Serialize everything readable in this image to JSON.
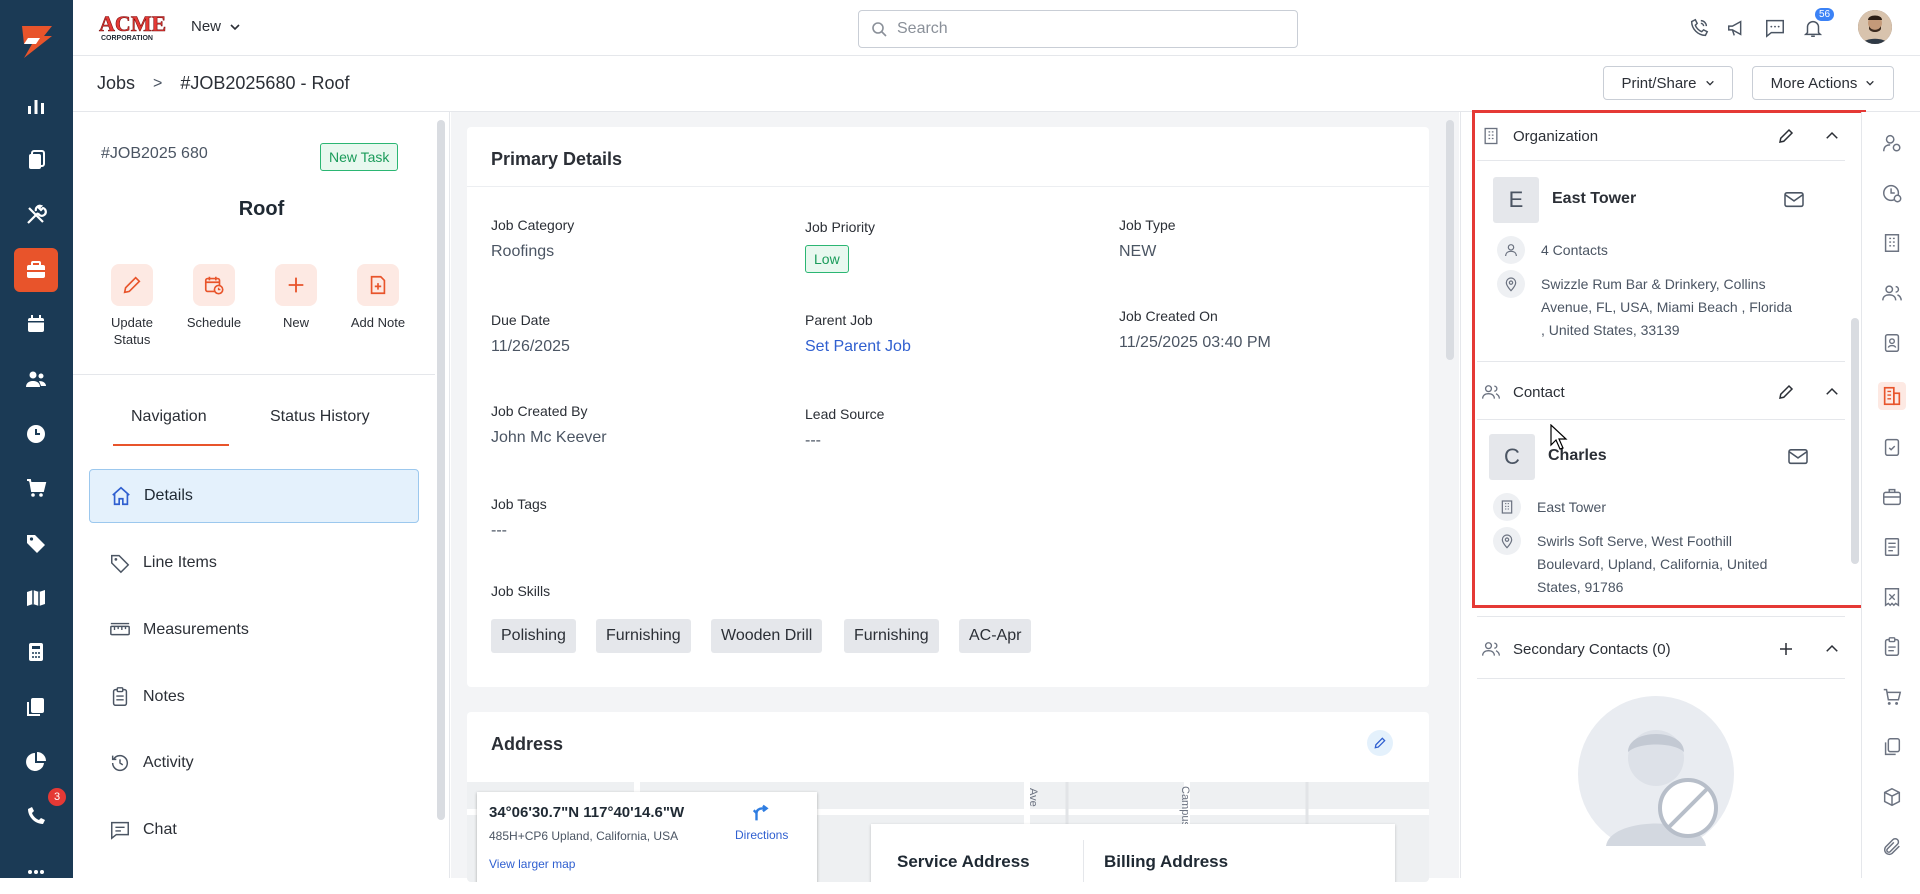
{
  "topbar": {
    "brand_name": "ACME",
    "brand_sub": "CORPORATION",
    "new_label": "New",
    "search_placeholder": "Search",
    "notif_count": "56"
  },
  "sidebar": {
    "chat_badge": "3"
  },
  "breadcrumb": {
    "root": "Jobs",
    "separator": ">",
    "current": "#JOB2025680 - Roof"
  },
  "actions": {
    "print_share": "Print/Share",
    "more_actions": "More Actions"
  },
  "job": {
    "number": "#JOB2025 680",
    "badge": "New Task",
    "title": "Roof",
    "quick_actions": [
      {
        "label": "Update Status"
      },
      {
        "label": "Schedule"
      },
      {
        "label": "New"
      },
      {
        "label": "Add Note"
      }
    ]
  },
  "tabs": {
    "navigation": "Navigation",
    "status_history": "Status History"
  },
  "nav": {
    "items": [
      {
        "label": "Details"
      },
      {
        "label": "Line Items"
      },
      {
        "label": "Measurements"
      },
      {
        "label": "Notes"
      },
      {
        "label": "Activity"
      },
      {
        "label": "Chat"
      }
    ]
  },
  "primary": {
    "title": "Primary Details",
    "fields": {
      "category": {
        "label": "Job Category",
        "value": "Roofings"
      },
      "priority": {
        "label": "Job Priority",
        "value": "Low"
      },
      "type": {
        "label": "Job Type",
        "value": "NEW"
      },
      "due": {
        "label": "Due Date",
        "value": "11/26/2025"
      },
      "parent": {
        "label": "Parent Job",
        "value": "Set Parent Job"
      },
      "created_on": {
        "label": "Job Created On",
        "value": "11/25/2025 03:40 PM"
      },
      "created_by": {
        "label": "Job Created By",
        "value": "John Mc Keever"
      },
      "lead": {
        "label": "Lead Source",
        "value": "---"
      },
      "tags": {
        "label": "Job Tags",
        "value": "---"
      },
      "skills_label": "Job Skills"
    },
    "skills": [
      "Polishing",
      "Furnishing",
      "Wooden Drill",
      "Furnishing",
      "AC-Apr"
    ]
  },
  "address": {
    "title": "Address",
    "coords": "34°06'30.7\"N 117°40'14.6\"W",
    "place": "485H+CP6 Upland, California, USA",
    "directions": "Directions",
    "larger_map": "View larger map",
    "street_1": "Ave",
    "street_2": "Campus",
    "service": "Service Address",
    "billing": "Billing Address"
  },
  "organization": {
    "section": "Organization",
    "initial": "E",
    "name": "East Tower",
    "contacts": "4 Contacts",
    "address": "Swizzle Rum Bar & Drinkery, Collins Avenue, FL, USA, Miami Beach , Florida , United States, 33139"
  },
  "contact": {
    "section": "Contact",
    "initial": "C",
    "name": "Charles",
    "org": "East Tower",
    "address": "Swirls Soft Serve, West Foothill Boulevard, Upland, California, United States, 91786"
  },
  "secondary": {
    "section": "Secondary Contacts (0)"
  }
}
